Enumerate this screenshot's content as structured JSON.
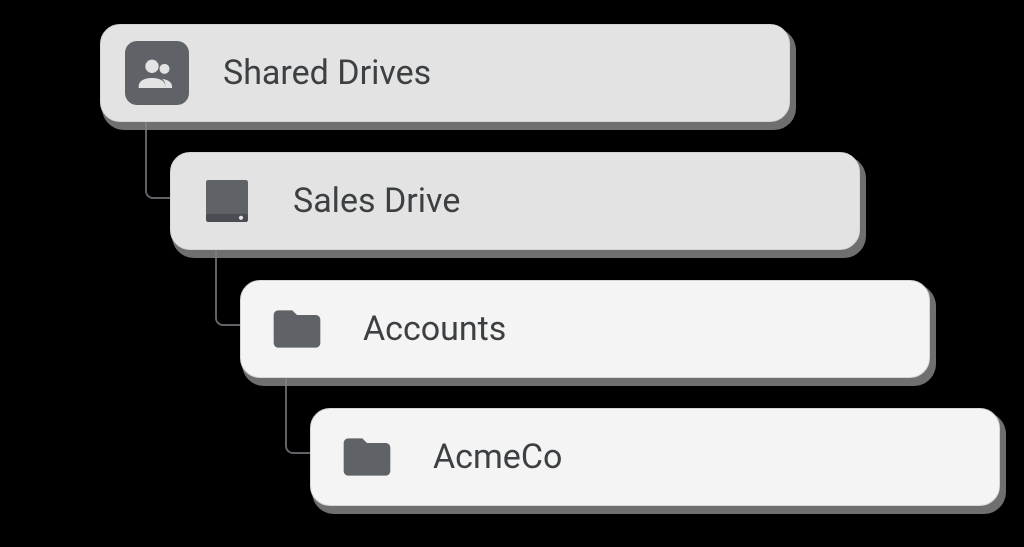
{
  "tree": {
    "nodes": [
      {
        "label": "Shared Drives",
        "icon": "people-icon",
        "depth": 0,
        "muted": true
      },
      {
        "label": "Sales Drive",
        "icon": "drive-icon",
        "depth": 1,
        "muted": true
      },
      {
        "label": "Accounts",
        "icon": "folder-icon",
        "depth": 2,
        "muted": false
      },
      {
        "label": "AcmeCo",
        "icon": "folder-icon",
        "depth": 3,
        "muted": false
      }
    ]
  },
  "colors": {
    "icon_dark": "#5f6368",
    "text": "#3c4043",
    "node_muted_bg": "#e3e3e3",
    "node_bg": "#f4f4f4",
    "shadow": "#8a8a8a"
  }
}
